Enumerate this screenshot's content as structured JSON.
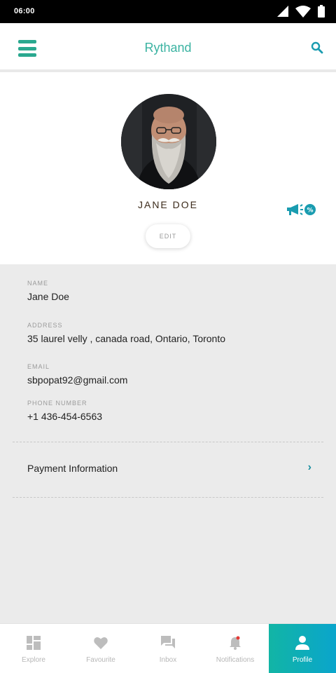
{
  "status_bar": {
    "time": "06:00"
  },
  "app_bar": {
    "title": "Rythand"
  },
  "profile": {
    "name": "JANE DOE",
    "edit_label": "EDIT"
  },
  "details": {
    "fields": [
      {
        "label": "NAME",
        "value": "Jane Doe"
      },
      {
        "label": "ADDRESS",
        "value": "35 laurel velly , canada road, Ontario, Toronto"
      },
      {
        "label": "EMAIL",
        "value": "sbpopat92@gmail.com"
      },
      {
        "label": "PHONE NUMBER",
        "value": "+1 436-454-6563"
      }
    ],
    "payment_label": "Payment Information"
  },
  "bottom_nav": {
    "items": [
      {
        "label": "Explore",
        "icon": "grid-icon"
      },
      {
        "label": "Favourite",
        "icon": "heart-icon"
      },
      {
        "label": "Inbox",
        "icon": "chat-icon"
      },
      {
        "label": "Notifications",
        "icon": "bell-icon"
      },
      {
        "label": "Profile",
        "icon": "person-icon",
        "active": true
      }
    ]
  },
  "colors": {
    "accent": "#3bb3a2",
    "active_tab_start": "#12b5a5",
    "active_tab_end": "#0aa5cc",
    "notification_dot": "#e53935"
  }
}
